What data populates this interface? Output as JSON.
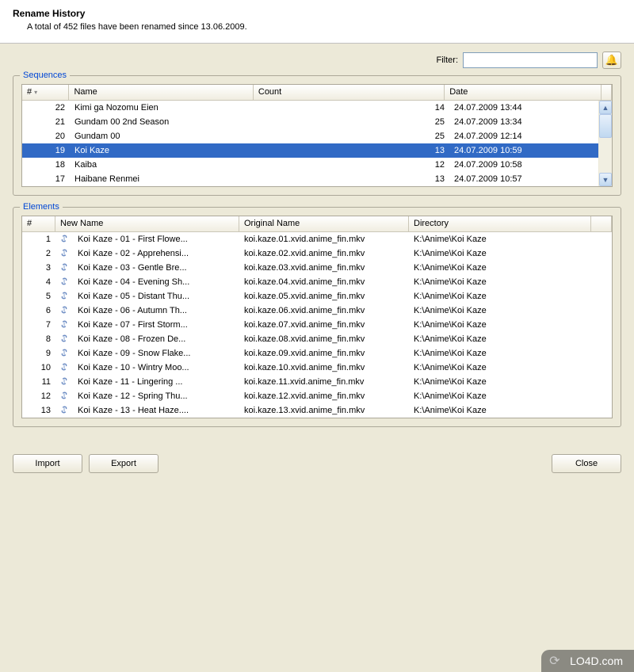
{
  "header": {
    "title": "Rename History",
    "subtitle": "A total of 452 files have been renamed since 13.06.2009."
  },
  "filter": {
    "label": "Filter:",
    "value": ""
  },
  "sequences": {
    "legend": "Sequences",
    "columns": {
      "num": "#",
      "name": "Name",
      "count": "Count",
      "date": "Date"
    },
    "selected_index": 3,
    "rows": [
      {
        "num": "22",
        "name": "Kimi ga Nozomu Eien",
        "count": "14",
        "date": "24.07.2009 13:44"
      },
      {
        "num": "21",
        "name": "Gundam 00 2nd Season",
        "count": "25",
        "date": "24.07.2009 13:34"
      },
      {
        "num": "20",
        "name": "Gundam 00",
        "count": "25",
        "date": "24.07.2009 12:14"
      },
      {
        "num": "19",
        "name": "Koi Kaze",
        "count": "13",
        "date": "24.07.2009 10:59"
      },
      {
        "num": "18",
        "name": "Kaiba",
        "count": "12",
        "date": "24.07.2009 10:58"
      },
      {
        "num": "17",
        "name": "Haibane Renmei",
        "count": "13",
        "date": "24.07.2009 10:57"
      }
    ]
  },
  "elements": {
    "legend": "Elements",
    "columns": {
      "num": "#",
      "new": "New Name",
      "orig": "Original Name",
      "dir": "Directory"
    },
    "rows": [
      {
        "num": "1",
        "new": "Koi Kaze - 01 - First Flowe...",
        "orig": "koi.kaze.01.xvid.anime_fin.mkv",
        "dir": "K:\\Anime\\Koi Kaze"
      },
      {
        "num": "2",
        "new": "Koi Kaze - 02 - Apprehensi...",
        "orig": "koi.kaze.02.xvid.anime_fin.mkv",
        "dir": "K:\\Anime\\Koi Kaze"
      },
      {
        "num": "3",
        "new": "Koi Kaze - 03 - Gentle Bre...",
        "orig": "koi.kaze.03.xvid.anime_fin.mkv",
        "dir": "K:\\Anime\\Koi Kaze"
      },
      {
        "num": "4",
        "new": "Koi Kaze - 04 - Evening Sh...",
        "orig": "koi.kaze.04.xvid.anime_fin.mkv",
        "dir": "K:\\Anime\\Koi Kaze"
      },
      {
        "num": "5",
        "new": "Koi Kaze - 05 - Distant Thu...",
        "orig": "koi.kaze.05.xvid.anime_fin.mkv",
        "dir": "K:\\Anime\\Koi Kaze"
      },
      {
        "num": "6",
        "new": "Koi Kaze - 06 - Autumn Th...",
        "orig": "koi.kaze.06.xvid.anime_fin.mkv",
        "dir": "K:\\Anime\\Koi Kaze"
      },
      {
        "num": "7",
        "new": "Koi Kaze - 07 - First Storm...",
        "orig": "koi.kaze.07.xvid.anime_fin.mkv",
        "dir": "K:\\Anime\\Koi Kaze"
      },
      {
        "num": "8",
        "new": "Koi Kaze - 08 - Frozen De...",
        "orig": "koi.kaze.08.xvid.anime_fin.mkv",
        "dir": "K:\\Anime\\Koi Kaze"
      },
      {
        "num": "9",
        "new": "Koi Kaze - 09 - Snow Flake...",
        "orig": "koi.kaze.09.xvid.anime_fin.mkv",
        "dir": "K:\\Anime\\Koi Kaze"
      },
      {
        "num": "10",
        "new": "Koi Kaze - 10 - Wintry Moo...",
        "orig": "koi.kaze.10.xvid.anime_fin.mkv",
        "dir": "K:\\Anime\\Koi Kaze"
      },
      {
        "num": "11",
        "new": "Koi Kaze - 11 - Lingering ...",
        "orig": "koi.kaze.11.xvid.anime_fin.mkv",
        "dir": "K:\\Anime\\Koi Kaze"
      },
      {
        "num": "12",
        "new": "Koi Kaze - 12 - Spring Thu...",
        "orig": "koi.kaze.12.xvid.anime_fin.mkv",
        "dir": "K:\\Anime\\Koi Kaze"
      },
      {
        "num": "13",
        "new": "Koi Kaze - 13 - Heat Haze....",
        "orig": "koi.kaze.13.xvid.anime_fin.mkv",
        "dir": "K:\\Anime\\Koi Kaze"
      }
    ]
  },
  "buttons": {
    "import": "Import",
    "export": "Export",
    "close": "Close"
  },
  "watermark": "LO4D.com"
}
